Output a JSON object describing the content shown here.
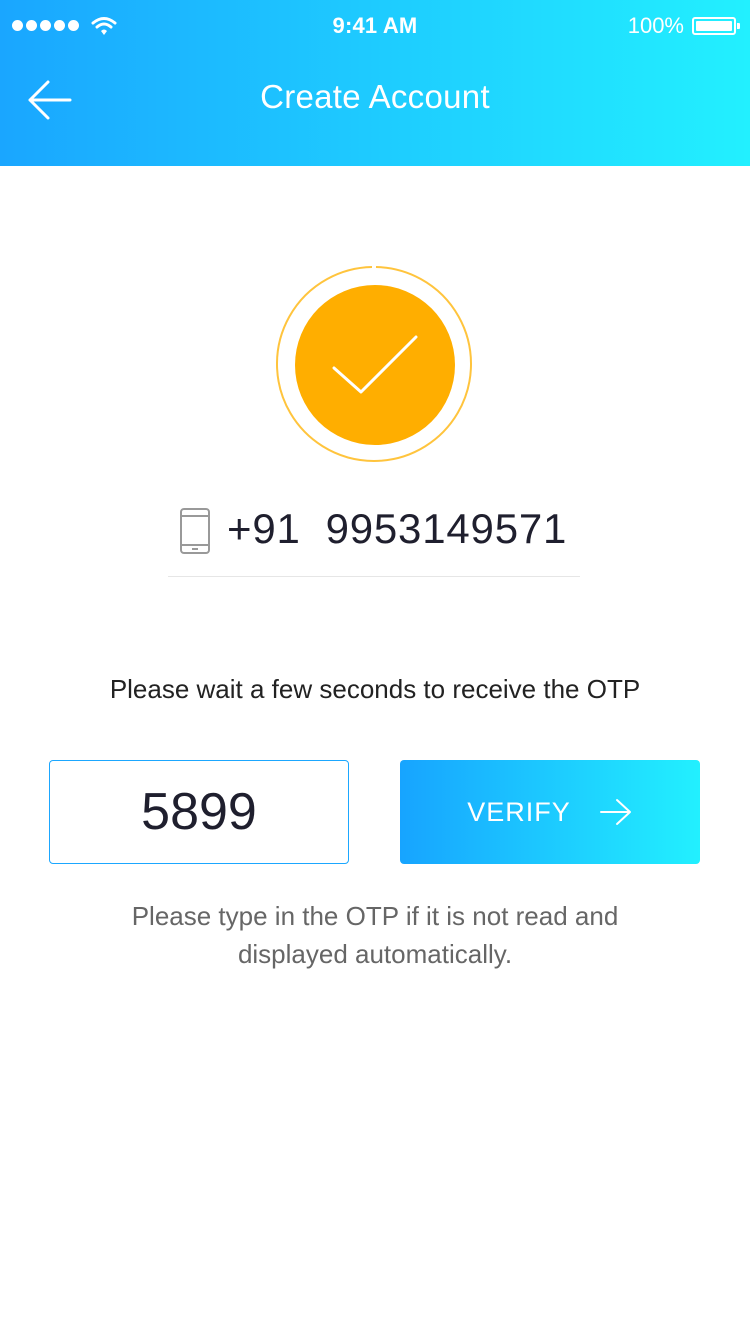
{
  "status_bar": {
    "time": "9:41 AM",
    "battery": "100%"
  },
  "header": {
    "title": "Create Account"
  },
  "phone": {
    "number": "+91  9953149571"
  },
  "otp": {
    "wait_message": "Please wait a few seconds to receive the OTP",
    "value": "5899",
    "verify_label": "VERIFY",
    "hint": "Please type in the OTP if it is not read and displayed automatically."
  },
  "colors": {
    "header_gradient_start": "#1aa6ff",
    "header_gradient_end": "#22f0ff",
    "success_orange": "#ffae00",
    "input_border": "#1ba7ff"
  },
  "icons": {
    "back": "arrow-left-icon",
    "success": "check-circle-icon",
    "phone": "mobile-phone-icon",
    "verify": "arrow-right-icon"
  }
}
